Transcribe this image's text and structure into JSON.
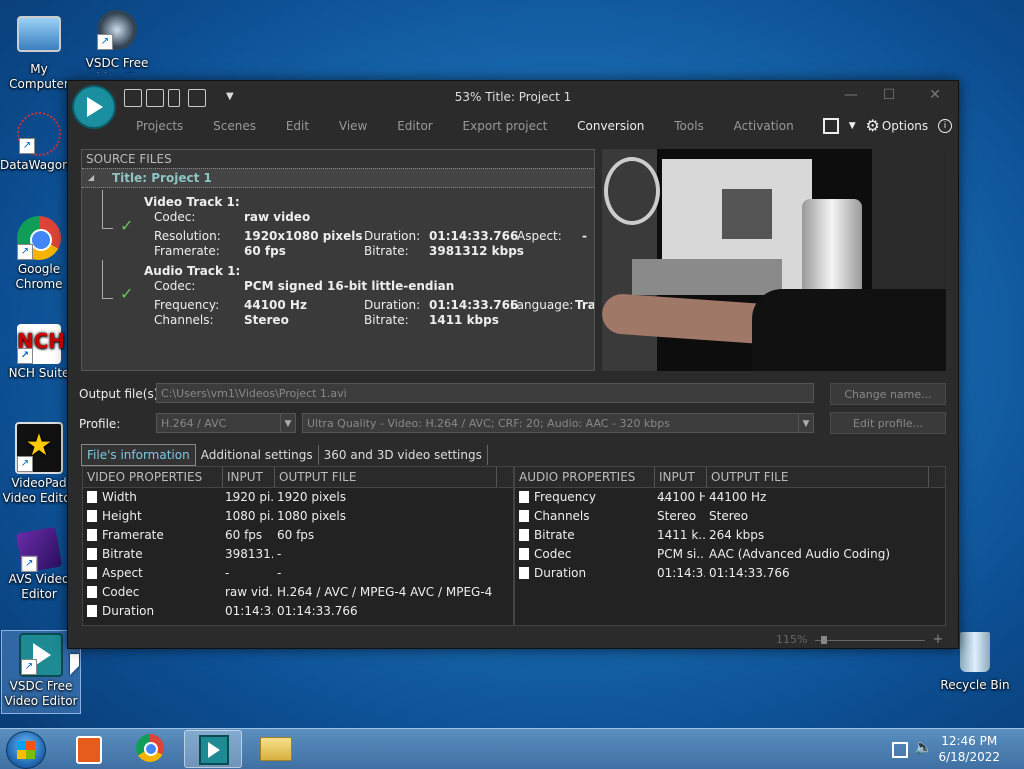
{
  "desktop": {
    "icons": [
      {
        "label": "My Computer"
      },
      {
        "label": "VSDC Free Video C..."
      },
      {
        "label": "DataWagon..."
      },
      {
        "label": "Google Chrome"
      },
      {
        "label": "NCH Suite"
      },
      {
        "label": "VideoPad Video Editor"
      },
      {
        "label": "AVS Video Editor"
      },
      {
        "label": "VSDC Free Video Editor"
      },
      {
        "label": "Recycle Bin"
      }
    ]
  },
  "window": {
    "title": "53% Title: Project 1",
    "menu": [
      "Projects",
      "Scenes",
      "Edit",
      "View",
      "Editor",
      "Export project",
      "Conversion",
      "Tools",
      "Activation"
    ],
    "active_menu": "Conversion",
    "options_label": "Options"
  },
  "source_files": {
    "header": "SOURCE FILES",
    "project": "Title: Project 1",
    "video_track": {
      "title": "Video Track 1:",
      "codec_label": "Codec:",
      "codec": "raw video",
      "resolution_label": "Resolution:",
      "resolution": "1920x1080 pixels",
      "duration_label": "Duration:",
      "duration": "01:14:33.766",
      "aspect_label": "Aspect:",
      "aspect": "-",
      "framerate_label": "Framerate:",
      "framerate": "60 fps",
      "bitrate_label": "Bitrate:",
      "bitrate": "3981312 kbps"
    },
    "audio_track": {
      "title": "Audio Track 1:",
      "codec_label": "Codec:",
      "codec": "PCM signed 16-bit little-endian",
      "frequency_label": "Frequency:",
      "frequency": "44100 Hz",
      "duration_label": "Duration:",
      "duration": "01:14:33.766",
      "language_label": "Language:",
      "language": "Tra",
      "channels_label": "Channels:",
      "channels": "Stereo",
      "bitrate_label": "Bitrate:",
      "bitrate": "1411 kbps"
    }
  },
  "output": {
    "label": "Output file(s):",
    "path": "C:\\Users\\vm1\\Videos\\Project 1.avi",
    "change_name": "Change name...",
    "profile_label": "Profile:",
    "profile": "H.264 / AVC",
    "profile_detail": "Ultra Quality - Video: H.264 / AVC; CRF: 20; Audio: AAC - 320 kbps",
    "edit_profile": "Edit profile..."
  },
  "tabs": [
    "File's information",
    "Additional settings",
    "360 and 3D video settings"
  ],
  "video_props": {
    "headers": [
      "VIDEO PROPERTIES",
      "INPUT ...",
      "OUTPUT FILE"
    ],
    "rows": [
      [
        "Width",
        "1920 pi...",
        "1920 pixels"
      ],
      [
        "Height",
        "1080 pi...",
        "1080 pixels"
      ],
      [
        "Framerate",
        "60 fps",
        "60 fps"
      ],
      [
        "Bitrate",
        "398131...",
        "-"
      ],
      [
        "Aspect",
        "-",
        "-"
      ],
      [
        "Codec",
        "raw vid...",
        "H.264 / AVC / MPEG-4 AVC / MPEG-4 ..."
      ],
      [
        "Duration",
        "01:14:3...",
        "01:14:33.766"
      ]
    ]
  },
  "audio_props": {
    "headers": [
      "AUDIO PROPERTIES",
      "INPUT ...",
      "OUTPUT FILE"
    ],
    "rows": [
      [
        "Frequency",
        "44100 Hz",
        "44100 Hz"
      ],
      [
        "Channels",
        "Stereo",
        "Stereo"
      ],
      [
        "Bitrate",
        "1411 k...",
        "264 kbps"
      ],
      [
        "Codec",
        "PCM si...",
        "AAC (Advanced Audio Coding)"
      ],
      [
        "Duration",
        "01:14:3...",
        "01:14:33.766"
      ]
    ]
  },
  "zoom_label": "115%",
  "taskbar": {
    "time": "12:46 PM",
    "date": "6/18/2022"
  }
}
